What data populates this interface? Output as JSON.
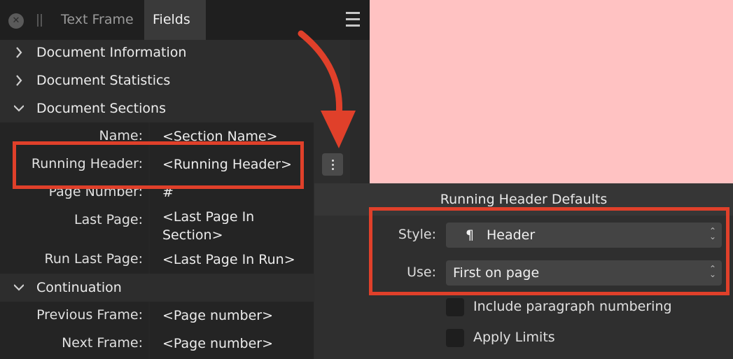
{
  "panel": {
    "tabs": [
      {
        "label": "Text Frame",
        "active": false
      },
      {
        "label": "Fields",
        "active": true
      }
    ],
    "sections": [
      {
        "label": "Document Information",
        "expanded": false
      },
      {
        "label": "Document Statistics",
        "expanded": false
      },
      {
        "label": "Document Sections",
        "expanded": true
      },
      {
        "label": "Continuation",
        "expanded": true
      }
    ],
    "section_fields": [
      {
        "label": "Name:",
        "value": "<Section Name>"
      },
      {
        "label": "Running Header:",
        "value": "<Running Header>"
      },
      {
        "label": "Page Number:",
        "value": "#"
      },
      {
        "label": "Last Page:",
        "value": "<Last Page In Section>"
      },
      {
        "label": "Run Last Page:",
        "value": "<Last Page In Run>"
      }
    ],
    "continuation_fields": [
      {
        "label": "Previous Frame:",
        "value": "<Page number>"
      },
      {
        "label": "Next Frame:",
        "value": "<Page number>"
      }
    ]
  },
  "popover": {
    "title": "Running Header Defaults",
    "style_label": "Style:",
    "style_icon": "¶",
    "style_value": "Header",
    "use_label": "Use:",
    "use_value": "First on page",
    "checkboxes": [
      {
        "label": "Include paragraph numbering",
        "checked": false
      },
      {
        "label": "Apply Limits",
        "checked": false
      }
    ]
  },
  "colors": {
    "highlight": "#e0402a",
    "canvas": "#ffc2c2",
    "panel_bg": "#2d2d2d"
  }
}
